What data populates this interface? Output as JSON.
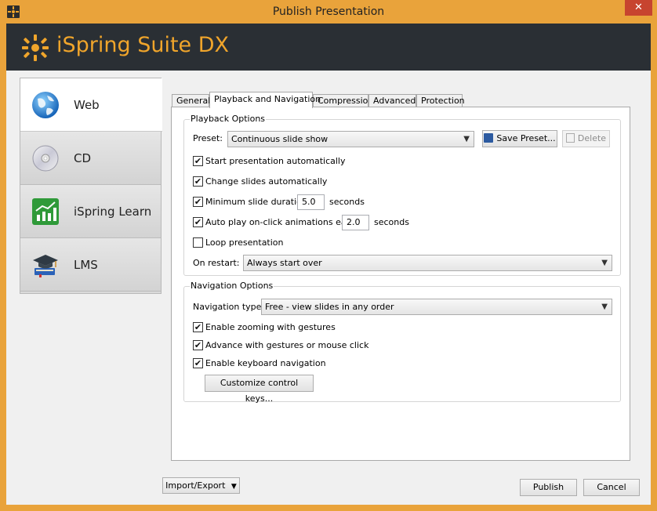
{
  "window": {
    "title": "Publish Presentation",
    "close_glyph": "✕"
  },
  "banner": {
    "brand": "iSpring Suite DX"
  },
  "sidebar": {
    "items": [
      {
        "label": "Web",
        "icon": "globe-icon",
        "active": true
      },
      {
        "label": "CD",
        "icon": "cd-icon",
        "active": false
      },
      {
        "label": "iSpring Learn",
        "icon": "chart-icon",
        "active": false
      },
      {
        "label": "LMS",
        "icon": "graduation-cap-icon",
        "active": false
      }
    ]
  },
  "tabs": [
    {
      "label": "General",
      "active": false
    },
    {
      "label": "Playback and Navigation",
      "active": true
    },
    {
      "label": "Compression",
      "active": false
    },
    {
      "label": "Advanced",
      "active": false
    },
    {
      "label": "Protection",
      "active": false
    }
  ],
  "playback": {
    "legend": "Playback Options",
    "preset_label": "Preset:",
    "preset_value": "Continuous slide show",
    "save_preset": "Save Preset...",
    "delete": "Delete",
    "start_auto": {
      "label": "Start presentation automatically",
      "checked": true
    },
    "change_auto": {
      "label": "Change slides automatically",
      "checked": true
    },
    "min_duration": {
      "label": "Minimum slide duration",
      "value": "5.0",
      "unit": "seconds",
      "checked": true
    },
    "auto_play": {
      "label": "Auto play on-click animations each",
      "value": "2.0",
      "unit": "seconds",
      "checked": true
    },
    "loop": {
      "label": "Loop presentation",
      "checked": false
    },
    "restart_label": "On restart:",
    "restart_value": "Always start over"
  },
  "navigation": {
    "legend": "Navigation Options",
    "type_label": "Navigation type:",
    "type_value": "Free - view slides in any order",
    "zoom": {
      "label": "Enable zooming with gestures",
      "checked": true
    },
    "advance": {
      "label": "Advance with gestures or mouse click",
      "checked": true
    },
    "keyboard": {
      "label": "Enable keyboard navigation",
      "checked": true
    },
    "customize": "Customize control keys..."
  },
  "footer": {
    "import_export": "Import/Export",
    "publish": "Publish",
    "cancel": "Cancel"
  },
  "colors": {
    "accent": "#e9a33b",
    "banner": "#2a2f34",
    "brand": "#f0a52b",
    "close": "#c7442f"
  }
}
